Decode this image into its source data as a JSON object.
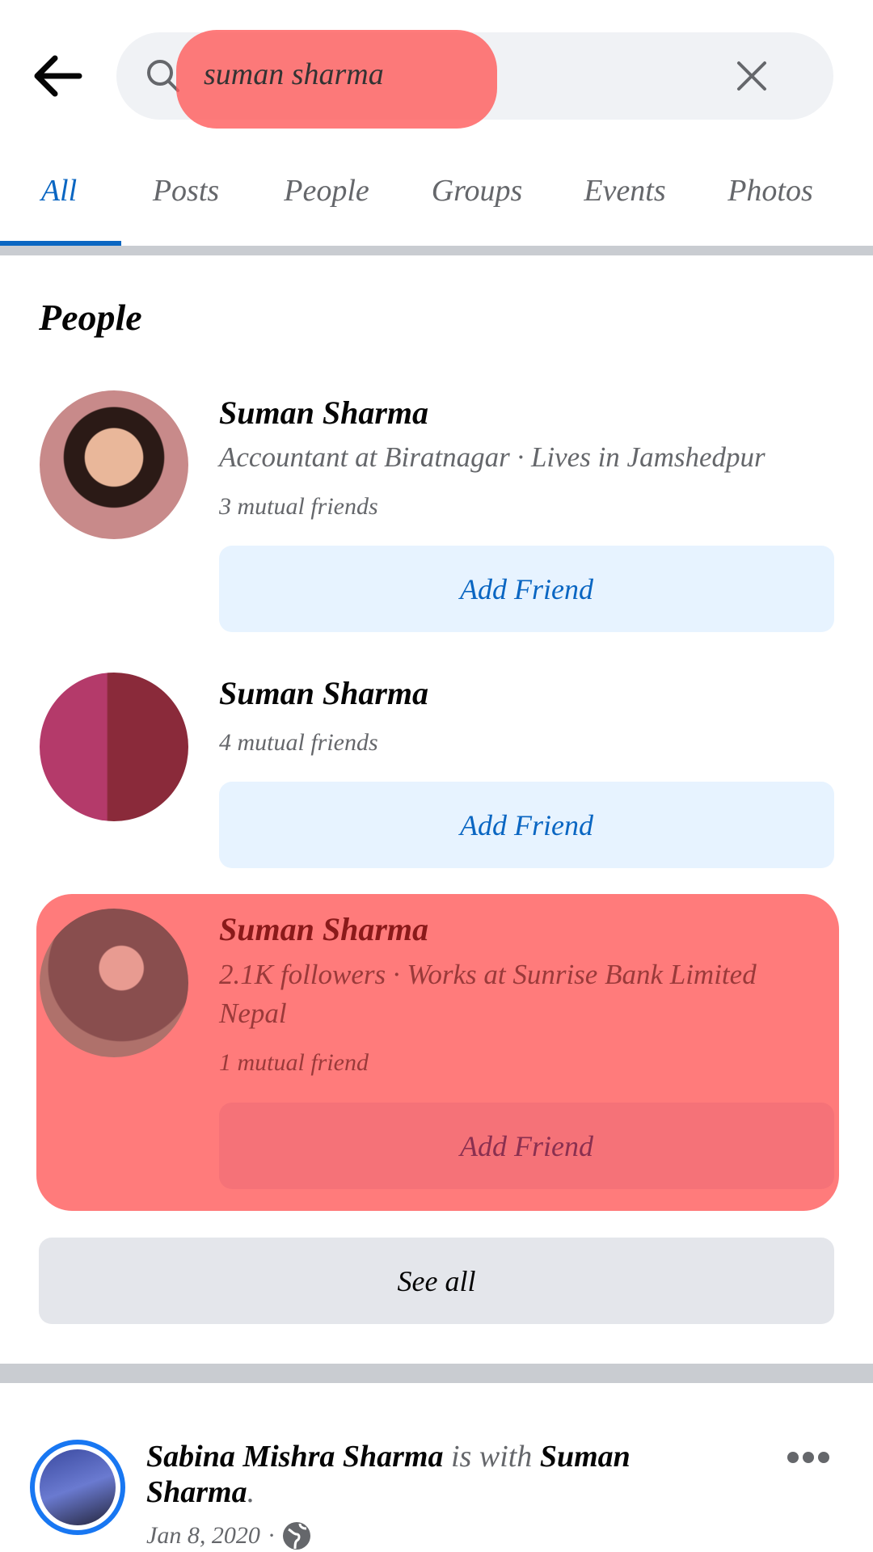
{
  "header": {
    "query": "suman sharma",
    "back_icon": "arrow-left-icon",
    "search_icon": "search-icon",
    "clear_icon": "close-icon"
  },
  "tabs": [
    {
      "label": "All",
      "active": true
    },
    {
      "label": "Posts"
    },
    {
      "label": "People"
    },
    {
      "label": "Groups"
    },
    {
      "label": "Events"
    },
    {
      "label": "Photos"
    }
  ],
  "people": {
    "heading": "People",
    "items": [
      {
        "name": "Suman Sharma",
        "subtitle": "Accountant at Biratnagar · Lives in Jamshedpur",
        "mutual": "3 mutual friends",
        "button": "Add Friend"
      },
      {
        "name": "Suman Sharma",
        "mutual": "4 mutual friends",
        "button": "Add Friend"
      },
      {
        "name": "Suman Sharma",
        "subtitle": "2.1K followers · Works at Sunrise Bank Limited",
        "subtitle2": "Nepal",
        "mutual": "1 mutual friend",
        "button": "Add Friend"
      }
    ],
    "see_all": "See all"
  },
  "post": {
    "author": "Sabina Mishra Sharma",
    "connector": " is with ",
    "with": "Suman",
    "with2": "Sharma",
    "period": ".",
    "date": "Jan 8, 2020",
    "separator": "·",
    "privacy_icon": "globe-icon",
    "more_icon": "more-dots-icon"
  },
  "colors": {
    "accent": "#0a66c2",
    "highlight": "#ff5a5a"
  }
}
